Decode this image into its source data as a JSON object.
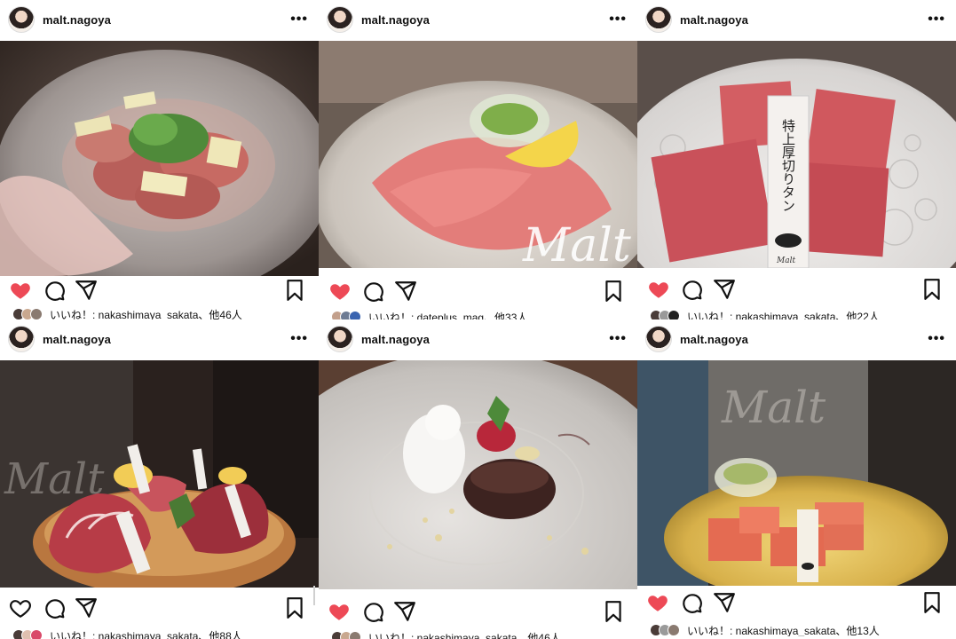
{
  "posts": [
    {
      "username": "malt.nagoya",
      "liked": true,
      "likes_text": "いいね！: nakashimaya_sakata、他46人"
    },
    {
      "username": "malt.nagoya",
      "liked": true,
      "likes_text": "いいね！: dateplus_mag、他33人"
    },
    {
      "username": "malt.nagoya",
      "liked": true,
      "likes_text": "いいね！: nakashimaya_sakata、他22人"
    },
    {
      "username": "malt.nagoya",
      "liked": false,
      "likes_text": "いいね！: nakashimaya_sakata、他88人"
    },
    {
      "username": "malt.nagoya",
      "liked": true,
      "likes_text": "いいね！: nakashimaya_sakata、他46人"
    },
    {
      "username": "malt.nagoya",
      "liked": true,
      "likes_text": "いいね！: nakashimaya_sakata、他13人"
    }
  ],
  "photo_text": {
    "post2_logo": "Malt",
    "post3_label": "特上厚切りタン",
    "post3_logo": "Malt",
    "post4_logo": "Malt",
    "post6_logo": "Malt"
  },
  "colors": {
    "heart": "#ed4956",
    "text": "#111111",
    "background": "#ffffff"
  },
  "icons": [
    "heart-icon",
    "comment-icon",
    "share-icon",
    "bookmark-icon",
    "more-icon"
  ]
}
